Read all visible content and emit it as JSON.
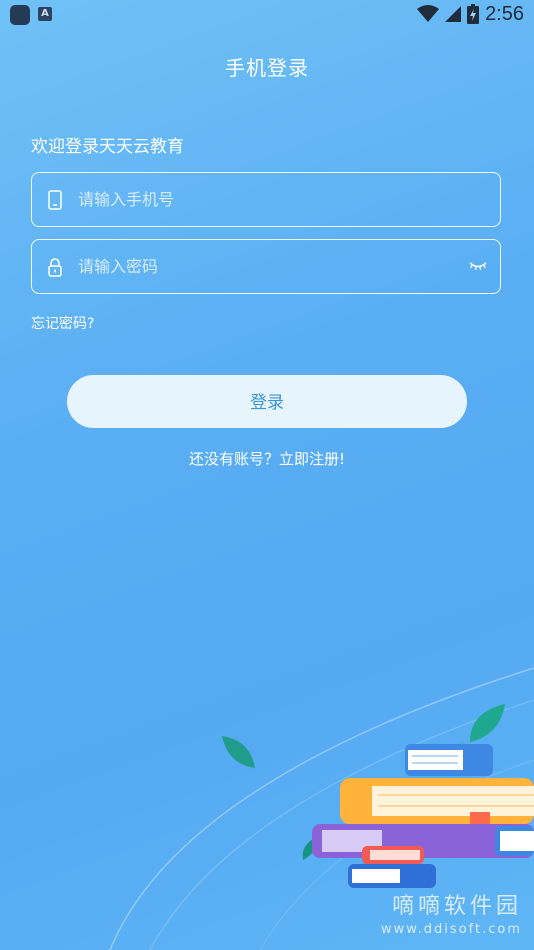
{
  "status_bar": {
    "time": "2:56",
    "left_icons": [
      "app-icon",
      "a-icon"
    ],
    "right_icons": [
      "wifi-icon",
      "signal-icon",
      "battery-icon"
    ]
  },
  "page": {
    "title": "手机登录",
    "welcome": "欢迎登录天天云教育"
  },
  "form": {
    "phone_placeholder": "请输入手机号",
    "password_placeholder": "请输入密码",
    "phone_value": "",
    "password_value": "",
    "forgot_label": "忘记密码?",
    "login_label": "登录",
    "register_label": "还没有账号？立即注册!"
  },
  "watermark": {
    "cn": "嘀嘀软件园",
    "url": "www.ddisoft.com"
  },
  "colors": {
    "background": "#5aaef3",
    "button_bg": "#e6f4fc",
    "button_text": "#3b95d6"
  }
}
